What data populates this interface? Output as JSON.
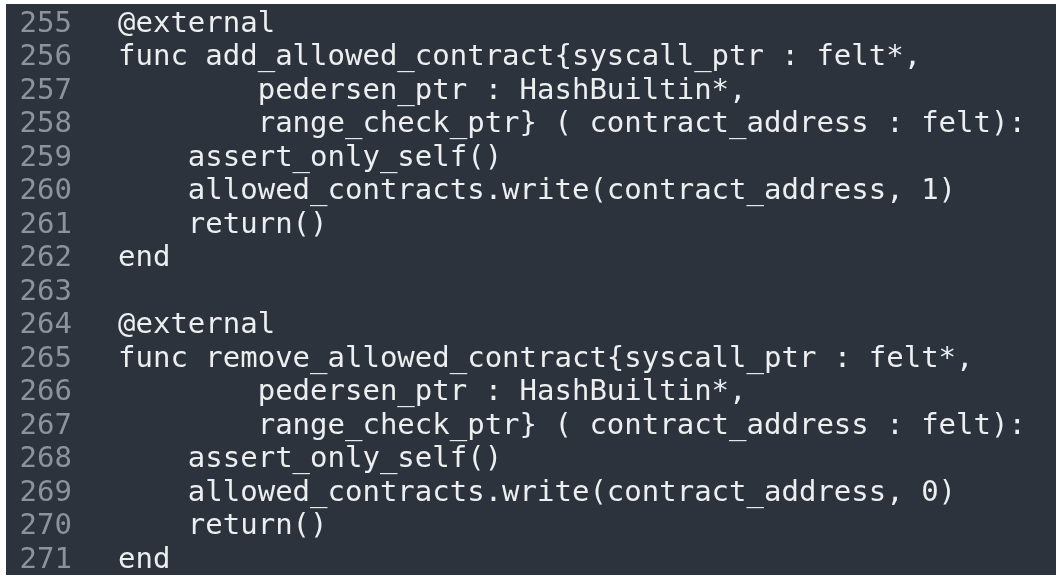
{
  "editor": {
    "lines": [
      {
        "number": "255",
        "text": "@external"
      },
      {
        "number": "256",
        "text": "func add_allowed_contract{syscall_ptr : felt*,"
      },
      {
        "number": "257",
        "text": "        pedersen_ptr : HashBuiltin*,"
      },
      {
        "number": "258",
        "text": "        range_check_ptr} ( contract_address : felt):"
      },
      {
        "number": "259",
        "text": "    assert_only_self()"
      },
      {
        "number": "260",
        "text": "    allowed_contracts.write(contract_address, 1)"
      },
      {
        "number": "261",
        "text": "    return()"
      },
      {
        "number": "262",
        "text": "end"
      },
      {
        "number": "263"
      },
      {
        "number": "264",
        "text": "@external"
      },
      {
        "number": "265",
        "text": "func remove_allowed_contract{syscall_ptr : felt*,"
      },
      {
        "number": "266",
        "text": "        pedersen_ptr : HashBuiltin*,"
      },
      {
        "number": "267",
        "text": "        range_check_ptr} ( contract_address : felt):"
      },
      {
        "number": "268",
        "text": "    assert_only_self()"
      },
      {
        "number": "269",
        "text": "    allowed_contracts.write(contract_address, 0)"
      },
      {
        "number": "270",
        "text": "    return()"
      },
      {
        "number": "271",
        "text": "end"
      }
    ]
  }
}
